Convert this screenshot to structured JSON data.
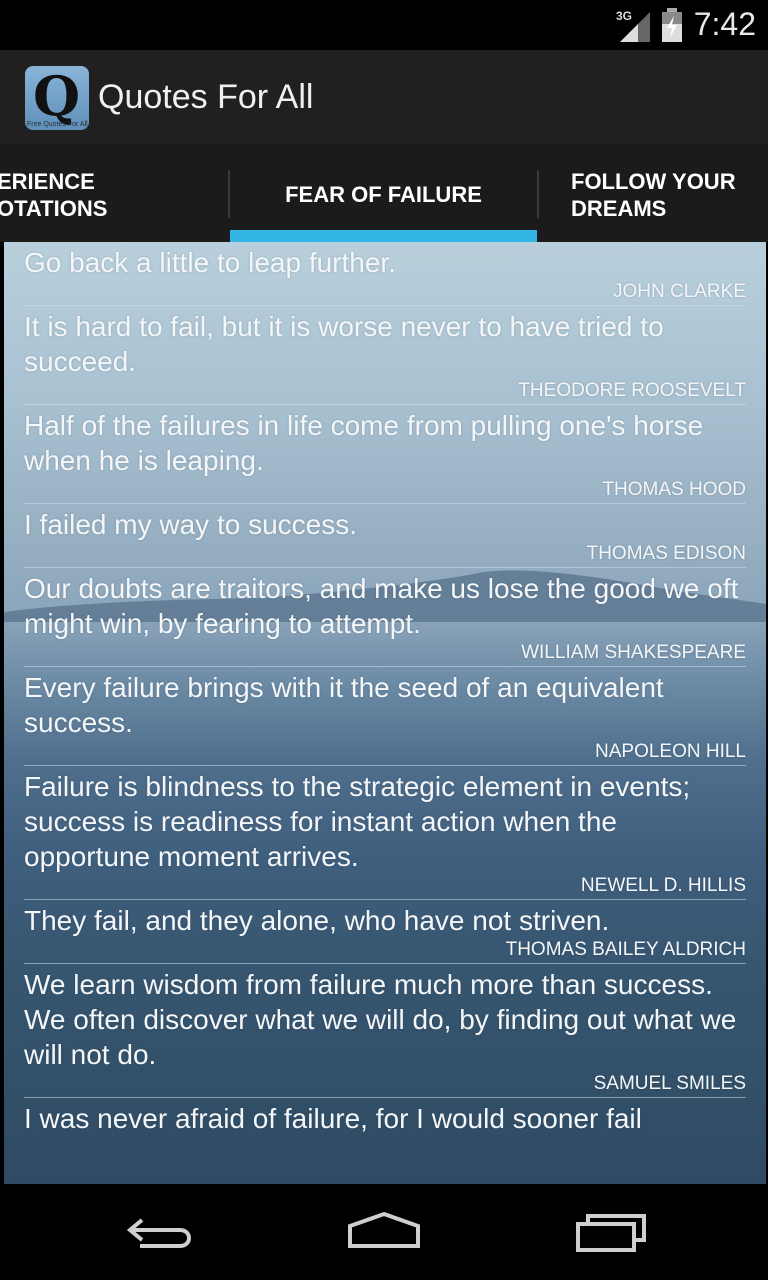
{
  "status_bar": {
    "time": "7:42",
    "network": "3G"
  },
  "app": {
    "title": "Quotes For All",
    "icon_text": "Q",
    "icon_caption": "Free Quotes For All"
  },
  "tabs": [
    {
      "line1": "ERIENCE",
      "line2": "OTATIONS"
    },
    {
      "line1": "FEAR OF FAILURE"
    },
    {
      "line1": "FOLLOW YOUR",
      "line2": "DREAMS"
    }
  ],
  "quotes": [
    {
      "text": "Go back a little to leap further.",
      "author": "JOHN CLARKE"
    },
    {
      "text": "It is hard to fail, but it is worse never to have tried to succeed.",
      "author": "THEODORE ROOSEVELT"
    },
    {
      "text": "Half of the failures in life come from pulling one's horse when he is leaping.",
      "author": "THOMAS HOOD"
    },
    {
      "text": "I failed my way to success.",
      "author": "THOMAS EDISON"
    },
    {
      "text": "Our doubts are traitors, and make us lose the good we oft might win, by fearing to attempt.",
      "author": "WILLIAM SHAKESPEARE"
    },
    {
      "text": "Every failure brings with it the seed of an equivalent success.",
      "author": "NAPOLEON HILL"
    },
    {
      "text": "Failure is blindness to the strategic element in events; success is readiness for instant action when the opportune moment arrives.",
      "author": "NEWELL D. HILLIS"
    },
    {
      "text": "They fail, and they alone, who have not striven.",
      "author": "THOMAS BAILEY ALDRICH"
    },
    {
      "text": "We learn wisdom from failure much more than success. We often discover what we will do, by finding out what we will not do.",
      "author": "SAMUEL SMILES"
    },
    {
      "text": "I was never afraid of failure, for I would sooner fail",
      "author": ""
    }
  ],
  "icons": {
    "signal": "signal-3g-icon",
    "battery": "battery-charging-icon",
    "back": "back-icon",
    "home": "home-icon",
    "recents": "recent-apps-icon"
  }
}
